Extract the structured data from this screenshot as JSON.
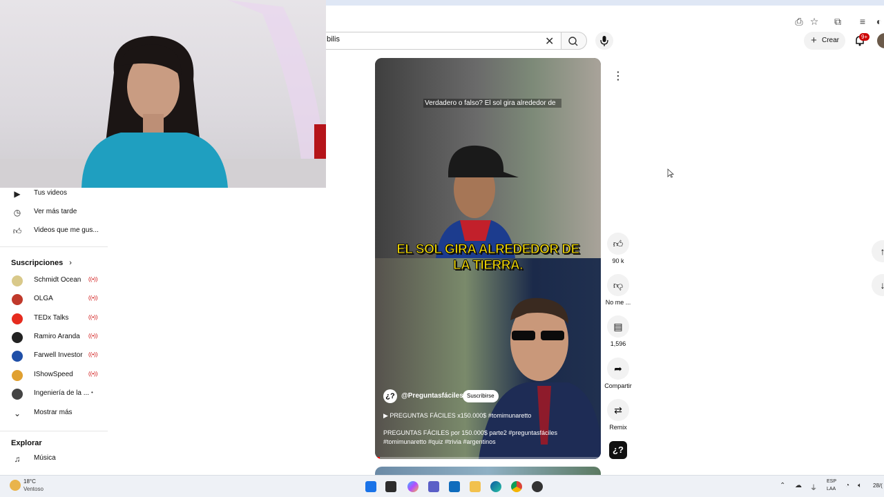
{
  "search": {
    "value": "bilis"
  },
  "header": {
    "create_label": "Crear",
    "notifications_badge": "9+"
  },
  "sidebar": {
    "you_items": [
      {
        "label": "Tus videos",
        "icon": "play-square-icon"
      },
      {
        "label": "Ver más tarde",
        "icon": "clock-icon"
      },
      {
        "label": "Videos que me gus...",
        "icon": "thumb-up-icon"
      }
    ],
    "subscriptions_heading": "Suscripciones",
    "subscriptions": [
      {
        "label": "Schmidt Ocean",
        "color": "#d9c98a"
      },
      {
        "label": "OLGA",
        "color": "#c0392b"
      },
      {
        "label": "TEDx Talks",
        "color": "#e62b1e"
      },
      {
        "label": "Ramiro Aranda",
        "color": "#222222"
      },
      {
        "label": "Farwell Investor",
        "color": "#1f4fa8"
      },
      {
        "label": "IShowSpeed",
        "color": "#e0a030"
      },
      {
        "label": "Ingeniería de la ...",
        "color": "#444444"
      }
    ],
    "show_more_label": "Mostrar más",
    "explore_heading": "Explorar",
    "explore_items": [
      {
        "label": "Música",
        "icon": "music-note-icon"
      }
    ]
  },
  "short": {
    "question": "Verdadero o falso? El sol gira alrededor de",
    "caption": "EL SOL GIRA ALREDEDOR DE LA TIERRA.",
    "channel_name": "@Preguntasfáciles",
    "channel_glyph": "¿?",
    "subscribe_label": "Suscribirse",
    "playlist": "PREGUNTAS FÁCILES x150.000$ #tomimunaretto",
    "description": "PREGUNTAS FÁCILES por 150.000$ parte2 #preguntasfáciles #tomimunaretto #quiz #trivia #argentinos",
    "progress": 0.02
  },
  "actions": {
    "likes": "90 k",
    "dislike_label": "No me ...",
    "comments": "1,596",
    "share_label": "Compartir",
    "remix_label": "Remix"
  },
  "taskbar": {
    "temperature": "18°C",
    "weather": "Ventoso",
    "lang_1": "ESP",
    "lang_2": "LAA",
    "date": "28/("
  }
}
